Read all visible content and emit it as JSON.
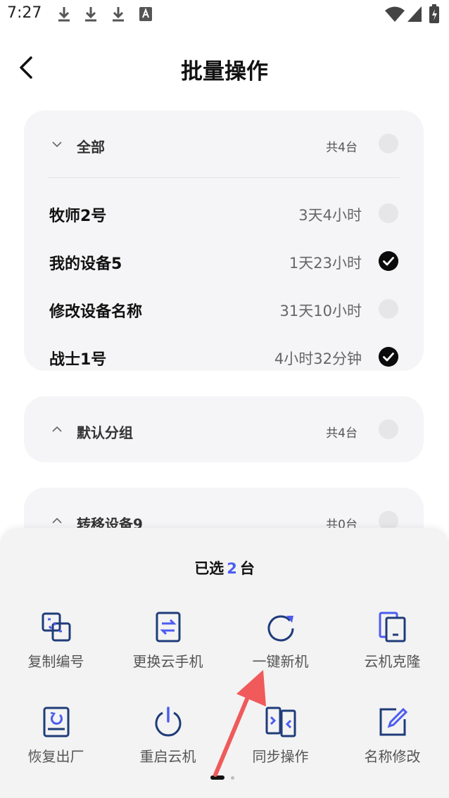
{
  "status_bar": {
    "time": "7:27"
  },
  "header": {
    "title": "批量操作"
  },
  "groups": [
    {
      "name": "全部",
      "count": "共4台",
      "expanded": true,
      "devices": [
        {
          "name": "牧师2号",
          "time": "3天4小时",
          "checked": false
        },
        {
          "name": "我的设备5",
          "time": "1天23小时",
          "checked": true
        },
        {
          "name": "修改设备名称",
          "time": "31天10小时",
          "checked": false
        },
        {
          "name": "战士1号",
          "time": "4小时32分钟",
          "checked": true
        }
      ]
    },
    {
      "name": "默认分组",
      "count": "共4台",
      "expanded": false
    },
    {
      "name": "转移设备9",
      "count": "共0台",
      "expanded": false
    }
  ],
  "bottom_sheet": {
    "selected_prefix": "已选",
    "selected_count": "2",
    "selected_suffix": "台",
    "actions": [
      {
        "label": "复制编号",
        "icon": "copy-id-icon"
      },
      {
        "label": "更换云手机",
        "icon": "swap-phone-icon"
      },
      {
        "label": "一键新机",
        "icon": "refresh-icon"
      },
      {
        "label": "云机克隆",
        "icon": "clone-icon"
      },
      {
        "label": "恢复出厂",
        "icon": "factory-reset-icon"
      },
      {
        "label": "重启云机",
        "icon": "power-icon"
      },
      {
        "label": "同步操作",
        "icon": "sync-icon"
      },
      {
        "label": "名称修改",
        "icon": "edit-icon"
      }
    ]
  },
  "colors": {
    "accent": "#4c5cf0",
    "action_icon": "#1f3c7a",
    "annotation_arrow": "#f05a5a"
  }
}
